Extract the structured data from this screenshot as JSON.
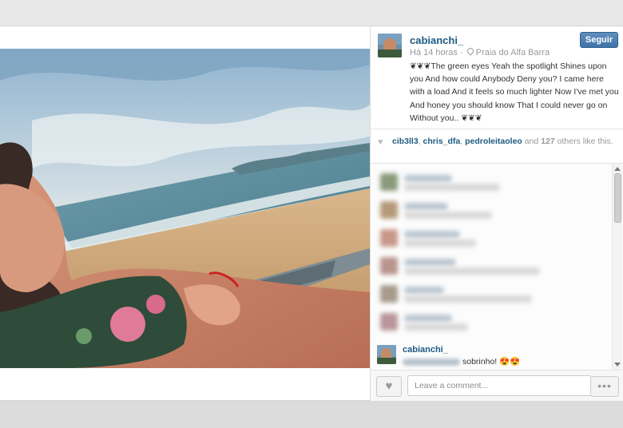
{
  "post": {
    "username": "cabianchi_",
    "follow_label": "Seguir",
    "time": "Há 14 horas",
    "separator": "·",
    "location": "Praia do Alfa Barra",
    "caption": "❦❦❦The green eyes Yeah the spotlight Shines upon you And how could Anybody Deny you? I came here with a load And it feels so much lighter Now I've met you And honey you should know That I could never go on Without you.. ❦❦❦"
  },
  "likes": {
    "icon": "heart-icon",
    "names": [
      "cib3ll3",
      "chris_dfa",
      "pedroleitaoleo"
    ],
    "conjunction": "and",
    "count": "127",
    "suffix": "others like this."
  },
  "comments": {
    "last": {
      "username": "cabianchi_",
      "text": "sobrinho! 😍😍"
    }
  },
  "footer": {
    "like_icon": "heart-icon",
    "comment_placeholder": "Leave a comment...",
    "more_label": "•••"
  },
  "colors": {
    "link": "#1d5a82",
    "follow_button": "#4a7db0"
  }
}
